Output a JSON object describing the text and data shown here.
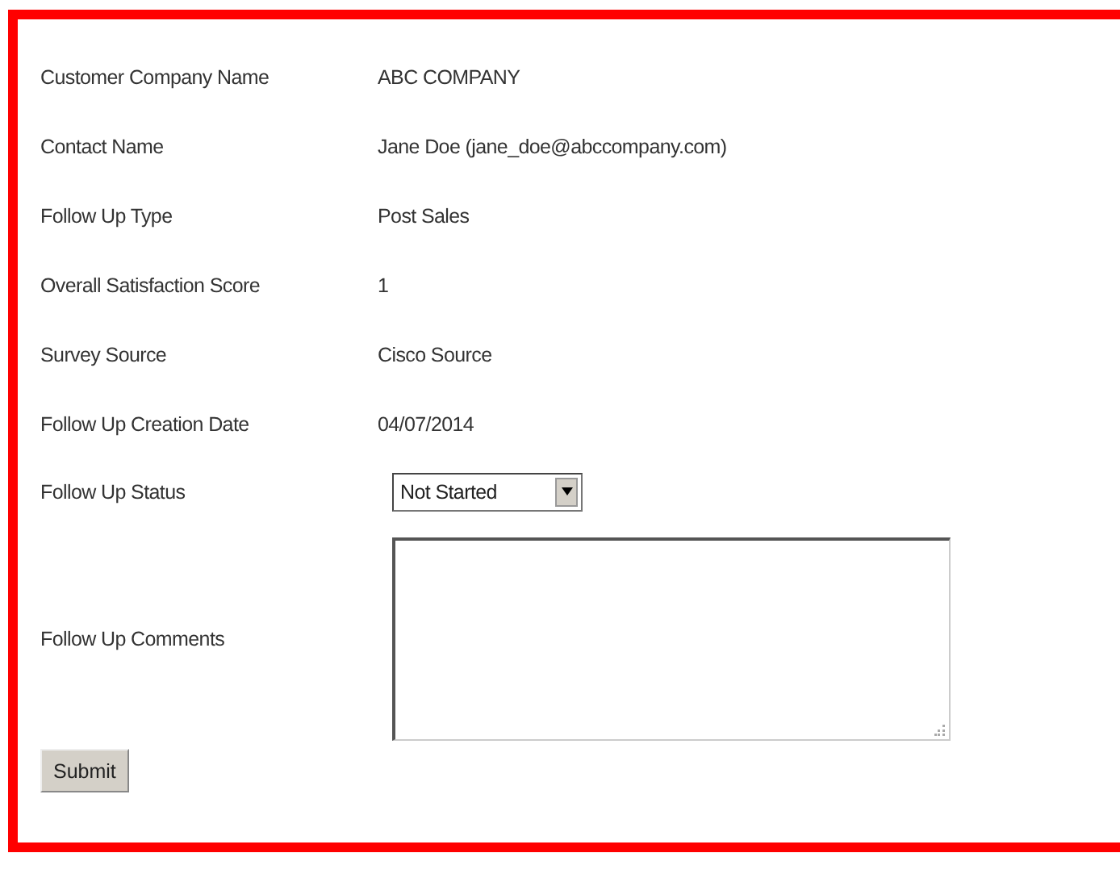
{
  "fields": [
    {
      "kind": "text",
      "label": "Customer Company Name",
      "value": "ABC COMPANY"
    },
    {
      "kind": "text",
      "label": "Contact Name",
      "value": "Jane Doe (jane_doe@abccompany.com)"
    },
    {
      "kind": "text",
      "label": "Follow Up Type",
      "value": "Post Sales"
    },
    {
      "kind": "text",
      "label": "Overall Satisfaction Score",
      "value": "1"
    },
    {
      "kind": "text",
      "label": "Survey Source",
      "value": "Cisco Source"
    },
    {
      "kind": "text",
      "label": "Follow Up Creation Date",
      "value": "04/07/2014"
    },
    {
      "kind": "select",
      "label": "Follow Up Status",
      "value": "Not Started"
    },
    {
      "kind": "textarea",
      "label": "Follow Up Comments"
    }
  ],
  "submit": "Submit"
}
